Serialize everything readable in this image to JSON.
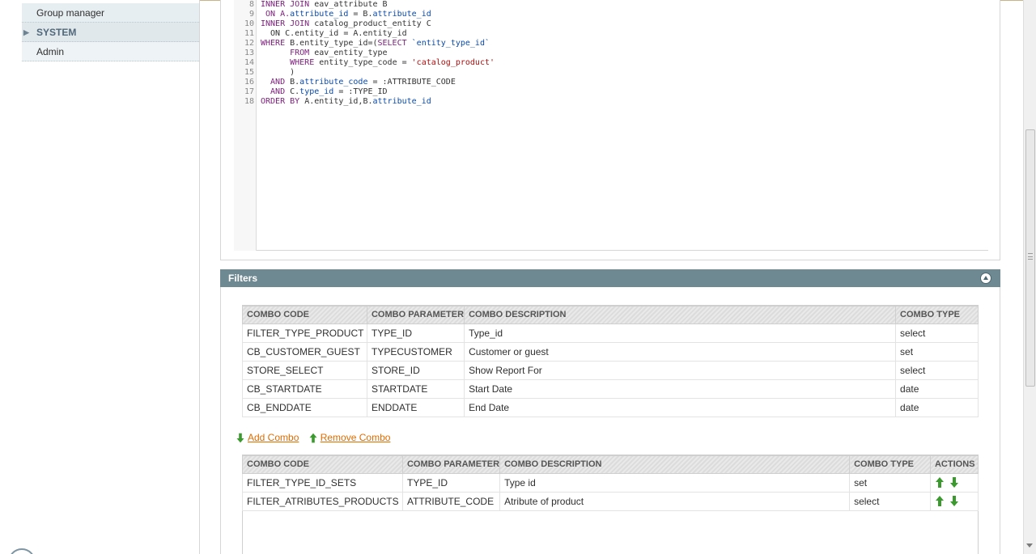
{
  "sidebar": {
    "items": [
      {
        "label": "Group manager"
      },
      {
        "label": "SYSTEM"
      },
      {
        "label": "Admin"
      }
    ]
  },
  "code": {
    "lines": [
      {
        "n": "8",
        "segments": [
          {
            "t": "INNER JOIN",
            "c": "kw"
          },
          {
            "t": " eav_attribute B",
            "c": ""
          }
        ]
      },
      {
        "n": "9",
        "segments": [
          {
            "t": " ON A.",
            "c": "kw"
          },
          {
            "t": "attribute_id",
            "c": "attr"
          },
          {
            "t": " = B.",
            "c": ""
          },
          {
            "t": "attribute_id",
            "c": "attr"
          }
        ]
      },
      {
        "n": "10",
        "segments": [
          {
            "t": "INNER JOIN",
            "c": "kw"
          },
          {
            "t": " catalog_product_entity C",
            "c": ""
          }
        ]
      },
      {
        "n": "11",
        "segments": [
          {
            "t": "  ON C.entity_id = A.entity_id",
            "c": ""
          }
        ]
      },
      {
        "n": "12",
        "segments": [
          {
            "t": "WHERE",
            "c": "kw"
          },
          {
            "t": " B.entity_type_id=(",
            "c": ""
          },
          {
            "t": "SELECT",
            "c": "kw"
          },
          {
            "t": " ",
            "c": ""
          },
          {
            "t": "`entity_type_id`",
            "c": "attr"
          }
        ]
      },
      {
        "n": "13",
        "segments": [
          {
            "t": "      ",
            "c": ""
          },
          {
            "t": "FROM",
            "c": "kw"
          },
          {
            "t": " eav_entity_type",
            "c": ""
          }
        ]
      },
      {
        "n": "14",
        "segments": [
          {
            "t": "      ",
            "c": ""
          },
          {
            "t": "WHERE",
            "c": "kw"
          },
          {
            "t": " entity_type_code = ",
            "c": ""
          },
          {
            "t": "'catalog_product'",
            "c": "str"
          }
        ]
      },
      {
        "n": "15",
        "segments": [
          {
            "t": "      )",
            "c": ""
          }
        ]
      },
      {
        "n": "16",
        "segments": [
          {
            "t": "  AND",
            "c": "kw"
          },
          {
            "t": " B.",
            "c": ""
          },
          {
            "t": "attribute_code",
            "c": "attr"
          },
          {
            "t": " = :ATTRIBUTE_CODE",
            "c": ""
          }
        ]
      },
      {
        "n": "17",
        "segments": [
          {
            "t": "  AND",
            "c": "kw"
          },
          {
            "t": " C.",
            "c": ""
          },
          {
            "t": "type_id",
            "c": "attr"
          },
          {
            "t": " = :TYPE_ID",
            "c": ""
          }
        ]
      },
      {
        "n": "18",
        "segments": [
          {
            "t": "ORDER BY",
            "c": "kw"
          },
          {
            "t": " A.entity_id,B.",
            "c": ""
          },
          {
            "t": "attribute_id",
            "c": "attr"
          }
        ]
      }
    ]
  },
  "filters": {
    "title": "Filters",
    "top_table": {
      "headers": [
        "COMBO CODE",
        "COMBO PARAMETER",
        "COMBO DESCRIPTION",
        "COMBO TYPE"
      ],
      "rows": [
        [
          "FILTER_TYPE_PRODUCT",
          "TYPE_ID",
          "Type_id",
          "select"
        ],
        [
          "CB_CUSTOMER_GUEST",
          "TYPECUSTOMER",
          "Customer or guest",
          "set"
        ],
        [
          "STORE_SELECT",
          "STORE_ID",
          "Show Report For",
          "select"
        ],
        [
          "CB_STARTDATE",
          "STARTDATE",
          "Start Date",
          "date"
        ],
        [
          "CB_ENDDATE",
          "ENDDATE",
          "End Date",
          "date"
        ]
      ]
    },
    "add_combo": "Add Combo",
    "remove_combo": "Remove Combo",
    "bottom_table": {
      "headers": [
        "COMBO CODE",
        "COMBO PARAMETER",
        "COMBO DESCRIPTION",
        "COMBO TYPE",
        "ACTIONS"
      ],
      "rows": [
        [
          "FILTER_TYPE_ID_SETS",
          "TYPE_ID",
          "Type id",
          "set"
        ],
        [
          "FILTER_ATRIBUTES_PRODUCTS",
          "ATTRIBUTE_CODE",
          "Atribute of product",
          "select"
        ]
      ]
    }
  },
  "colors": {
    "panel_header": "#6f8992",
    "link": "#e06c00",
    "arrow": "#3b9a2e"
  }
}
